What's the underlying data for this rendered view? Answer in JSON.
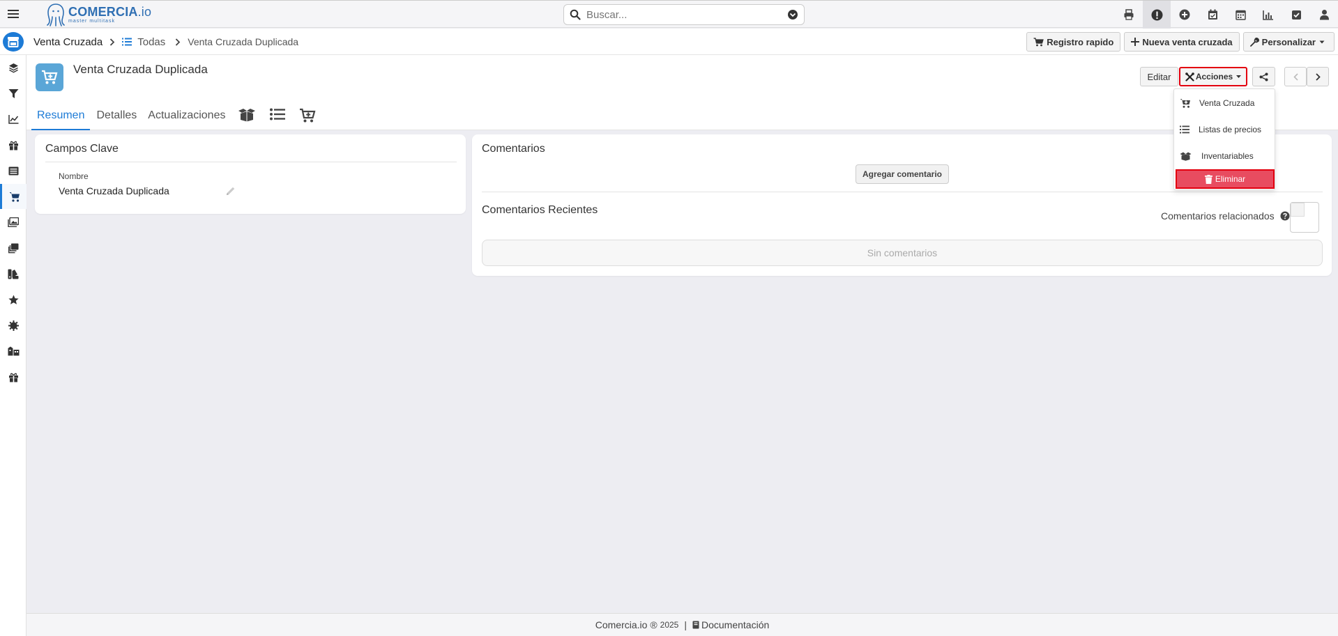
{
  "app": {
    "logo_name": "COMERCIA",
    "logo_suffix": ".io",
    "logo_tagline": "master multitask"
  },
  "search": {
    "placeholder": "Buscar..."
  },
  "top_icons": [
    "printer-icon",
    "alert-icon",
    "add-circle-icon",
    "calendar-check-icon",
    "calendar-icon",
    "bar-chart-icon",
    "checkbox-icon",
    "user-icon"
  ],
  "breadcrumb": {
    "module": "Venta Cruzada",
    "list": "Todas",
    "record": "Venta Cruzada Duplicada"
  },
  "crumb_actions": {
    "quick_register": "Registro rapido",
    "new": "Nueva venta cruzada",
    "customize": "Personalizar"
  },
  "sidebar_items": [
    "layers-icon",
    "filter-icon",
    "chart-line-icon",
    "gift-icon",
    "list-icon",
    "cart-icon",
    "gallery-icon",
    "stack-icon",
    "swatch-icon",
    "star-icon",
    "gear-icon",
    "warehouse-icon",
    "gift-icon"
  ],
  "record": {
    "title": "Venta Cruzada Duplicada",
    "tabs": [
      "Resumen",
      "Detalles",
      "Actualizaciones"
    ],
    "edit_label": "Editar",
    "actions_label": "Acciones"
  },
  "actions_menu": {
    "items": [
      "Venta Cruzada",
      "Listas de precios",
      "Inventariables"
    ],
    "delete_label": "Eliminar"
  },
  "key_fields": {
    "title": "Campos Clave",
    "name_label": "Nombre",
    "name_value": "Venta Cruzada Duplicada"
  },
  "comments": {
    "title": "Comentarios",
    "add_button": "Agregar comentario",
    "recent_title": "Comentarios Recientes",
    "related_label": "Comentarios relacionados",
    "empty_text": "Sin comentarios"
  },
  "footer": {
    "brand": "Comercia.io ®",
    "year": "2025",
    "separator": "|",
    "docs": "Documentación"
  },
  "colors": {
    "primary": "#1d7bd6",
    "record_icon": "#5aa6d7",
    "danger": "#e84c60",
    "highlight_border": "#e3000f"
  }
}
